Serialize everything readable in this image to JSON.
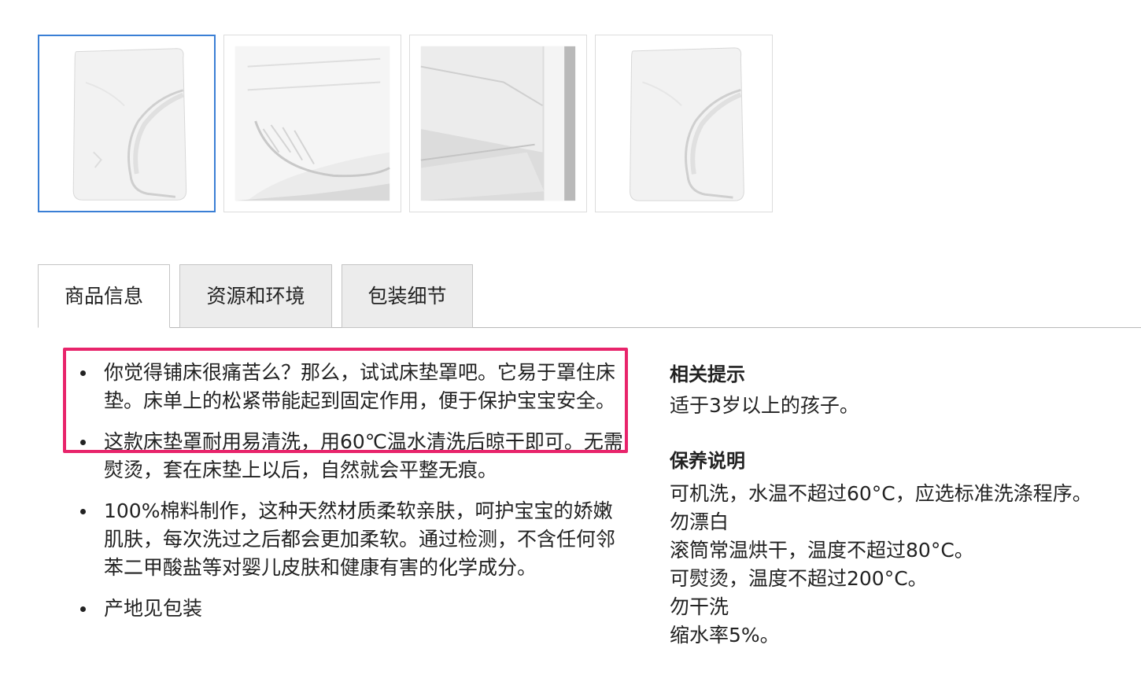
{
  "thumbnails": [
    {
      "label": "fitted-sheet-flat",
      "selected": true
    },
    {
      "label": "fitted-sheet-corner-closeup",
      "selected": false
    },
    {
      "label": "fitted-sheet-on-bed",
      "selected": false
    },
    {
      "label": "fitted-sheet-flat-alt",
      "selected": false
    }
  ],
  "tabs": [
    {
      "label": "商品信息"
    },
    {
      "label": "资源和环境"
    },
    {
      "label": "包装细节"
    }
  ],
  "features": [
    "你觉得铺床很痛苦么？那么，试试床垫罩吧。它易于罩住床垫。床单上的松紧带能起到固定作用，便于保护宝宝安全。",
    "这款床垫罩耐用易清洗，用60℃温水清洗后晾干即可。无需熨烫，套在床垫上以后，自然就会平整无痕。",
    "100%棉料制作，这种天然材质柔软亲肤，呵护宝宝的娇嫩肌肤，每次洗过之后都会更加柔软。通过检测，不含任何邻苯二甲酸盐等对婴儿皮肤和健康有害的化学成分。",
    "产地见包装"
  ],
  "tips": {
    "heading": "相关提示",
    "text": "适于3岁以上的孩子。"
  },
  "care": {
    "heading": "保养说明",
    "lines": [
      "可机洗，水温不超过60°C，应选标准洗涤程序。",
      "勿漂白",
      "滚筒常温烘干，温度不超过80°C。",
      "可熨烫，温度不超过200°C。",
      "勿干洗",
      "缩水率5%。"
    ]
  },
  "colors": {
    "selected_border": "#3a7fd5",
    "highlight": "#e8246b",
    "tab_inactive": "#ececec"
  }
}
